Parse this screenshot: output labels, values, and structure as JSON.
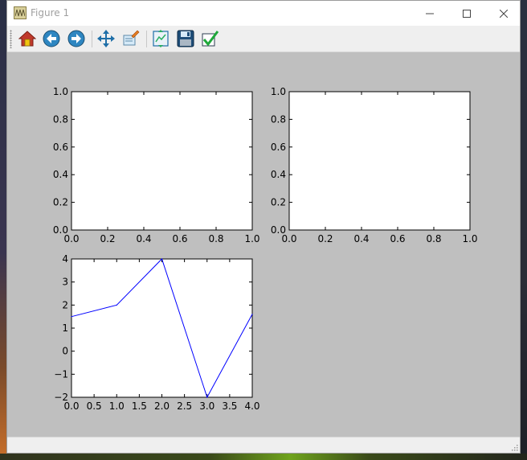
{
  "window": {
    "title": "Figure 1"
  },
  "toolbar": {
    "buttons": [
      {
        "name": "home-button",
        "icon": "home-icon"
      },
      {
        "name": "back-button",
        "icon": "back-arrow-icon"
      },
      {
        "name": "forward-button",
        "icon": "forward-arrow-icon"
      },
      {
        "name": "pan-button",
        "icon": "pan-move-icon"
      },
      {
        "name": "zoom-button",
        "icon": "zoom-rect-icon"
      },
      {
        "name": "subplots-button",
        "icon": "subplots-config-icon"
      },
      {
        "name": "save-button",
        "icon": "save-disk-icon"
      },
      {
        "name": "customize-button",
        "icon": "checkmark-icon"
      }
    ]
  },
  "chart_data": [
    {
      "type": "line",
      "position": "top-left",
      "x": [],
      "y": [],
      "xlim": [
        0.0,
        1.0
      ],
      "ylim": [
        0.0,
        1.0
      ],
      "xticks": [
        "0.0",
        "0.2",
        "0.4",
        "0.6",
        "0.8",
        "1.0"
      ],
      "yticks": [
        "0.0",
        "0.2",
        "0.4",
        "0.6",
        "0.8",
        "1.0"
      ],
      "grid": false
    },
    {
      "type": "line",
      "position": "top-right",
      "x": [],
      "y": [],
      "xlim": [
        0.0,
        1.0
      ],
      "ylim": [
        0.0,
        1.0
      ],
      "xticks": [
        "0.0",
        "0.2",
        "0.4",
        "0.6",
        "0.8",
        "1.0"
      ],
      "yticks": [
        "0.0",
        "0.2",
        "0.4",
        "0.6",
        "0.8",
        "1.0"
      ],
      "grid": false
    },
    {
      "type": "line",
      "position": "bottom-left",
      "series": [
        {
          "color": "#0000ff",
          "x": [
            0,
            1,
            2,
            3,
            4
          ],
          "y": [
            1.5,
            2,
            4,
            -2,
            1.6
          ]
        }
      ],
      "xlim": [
        0.0,
        4.0
      ],
      "ylim": [
        -2,
        4
      ],
      "xticks": [
        "0.0",
        "0.5",
        "1.0",
        "1.5",
        "2.0",
        "2.5",
        "3.0",
        "3.5",
        "4.0"
      ],
      "yticks": [
        "−2",
        "−1",
        "0",
        "1",
        "2",
        "3",
        "4"
      ],
      "grid": false
    }
  ]
}
